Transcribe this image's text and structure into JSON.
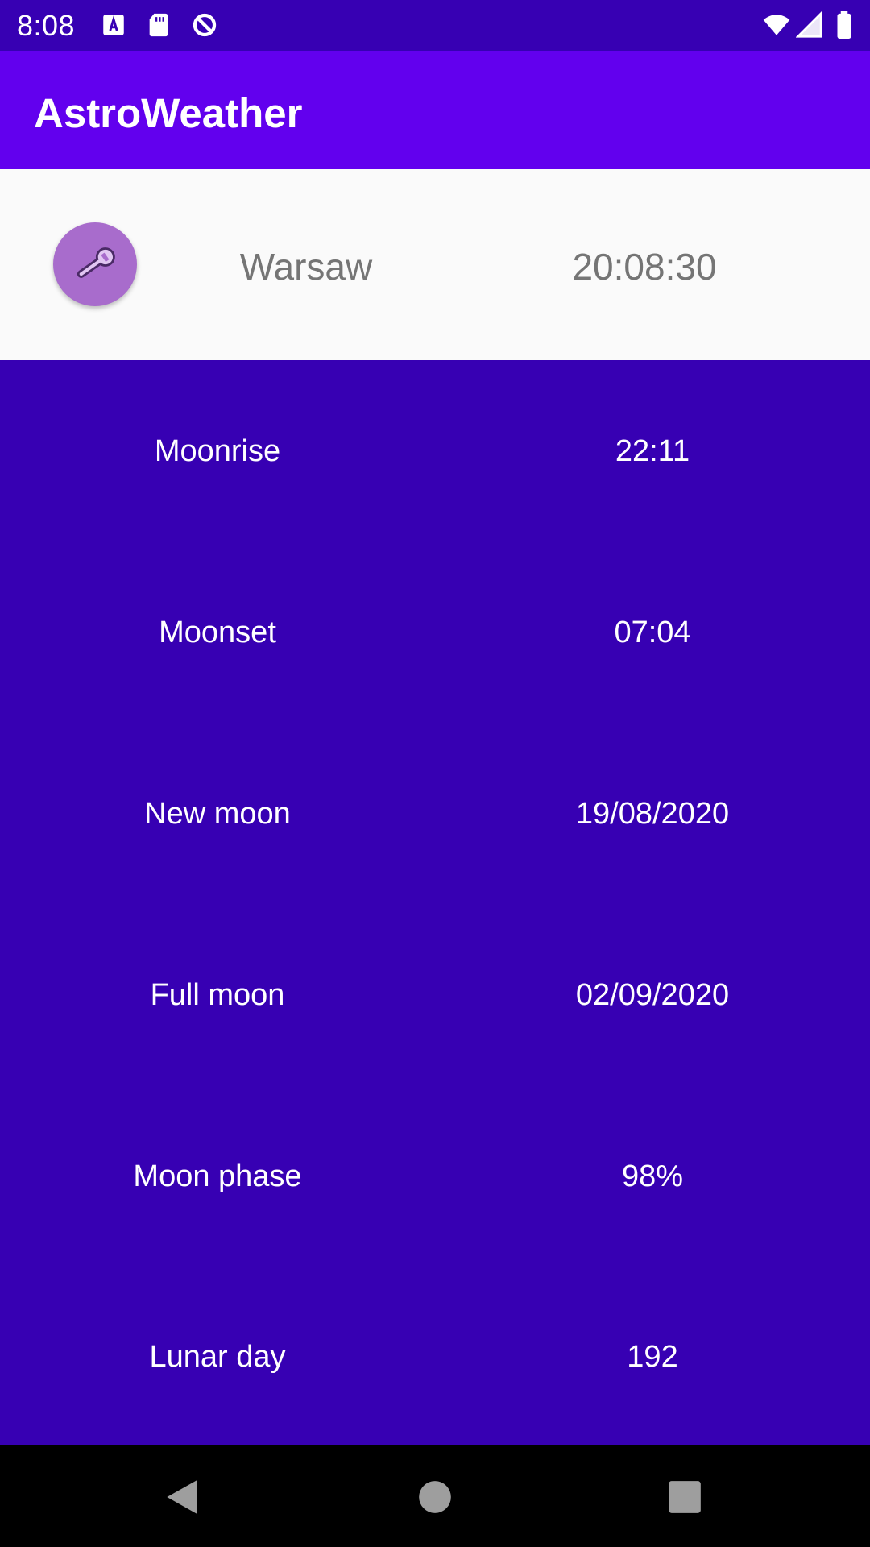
{
  "status_bar": {
    "time": "8:08",
    "left_icons": [
      "font-download-icon",
      "sd-card-icon",
      "vpn-icon"
    ],
    "right_icons": [
      "wifi-icon",
      "cellular-signal-icon",
      "battery-icon"
    ]
  },
  "app_bar": {
    "title": "AstroWeather"
  },
  "header": {
    "settings_icon": "wrench-icon",
    "city": "Warsaw",
    "time": "20:08:30"
  },
  "moon_info": [
    {
      "label": "Moonrise",
      "value": "22:11"
    },
    {
      "label": "Moonset",
      "value": "07:04"
    },
    {
      "label": "New moon",
      "value": "19/08/2020"
    },
    {
      "label": "Full moon",
      "value": "02/09/2020"
    },
    {
      "label": "Moon phase",
      "value": "98%"
    },
    {
      "label": "Lunar day",
      "value": "192"
    }
  ],
  "nav_bar": {
    "buttons": [
      "back-icon",
      "home-icon",
      "recents-icon"
    ]
  },
  "colors": {
    "primary": "#6200EE",
    "primary_dark": "#3700B3",
    "fab": "#A86CCC",
    "header_bg": "#FAFAFA",
    "header_text": "#757575"
  }
}
